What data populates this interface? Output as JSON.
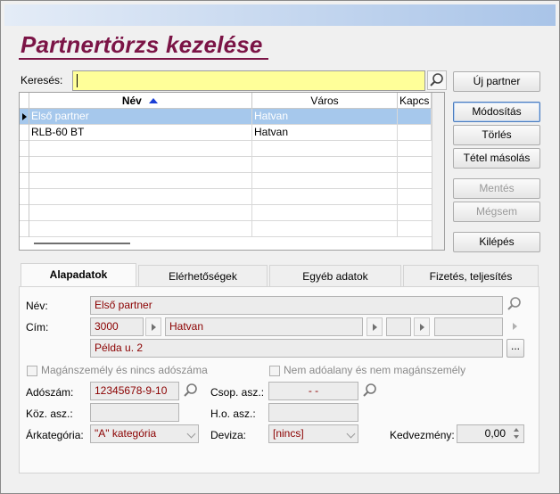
{
  "app_title": "Partnertörzs kezelése",
  "search": {
    "label": "Keresés:",
    "value": ""
  },
  "buttons": {
    "new_partner": "Új partner",
    "modify": "Módosítás",
    "delete": "Törlés",
    "copy_item": "Tétel másolás",
    "save": "Mentés",
    "cancel": "Mégsem",
    "exit": "Kilépés"
  },
  "grid": {
    "columns": [
      "Név",
      "Város",
      "Kapcs"
    ],
    "rows": [
      {
        "name": "Első partner",
        "city": "Hatvan",
        "selected": true
      },
      {
        "name": "RLB-60 BT",
        "city": "Hatvan",
        "selected": false
      }
    ]
  },
  "tabs": [
    "Alapadatok",
    "Elérhetőségek",
    "Egyéb adatok",
    "Fizetés, teljesítés"
  ],
  "form": {
    "name_label": "Név:",
    "name_value": "Első partner",
    "address_label": "Cím:",
    "zip": "3000",
    "city": "Hatvan",
    "street": "Példa u. 2",
    "private_person_label": "Magánszemély és nincs adószáma",
    "non_taxable_label": "Nem adóalany és nem magánszemély",
    "tax_id_label": "Adószám:",
    "tax_id_value": "12345678-9-10",
    "group_tax_label": "Csop. asz.:",
    "group_tax_value": "- -",
    "community_tax_label": "Köz. asz.:",
    "ho_tax_label": "H.o. asz.:",
    "price_category_label": "Árkategória:",
    "price_category_value": "\"A\" kategória",
    "currency_label": "Deviza:",
    "currency_value": "[nincs]",
    "discount_label": "Kedvezmény:",
    "discount_value": "0,00"
  },
  "colors": {
    "title": "#7b1446",
    "search_bg": "#ffff99",
    "selection": "#a6c8ec",
    "field_text": "#8b0000"
  }
}
